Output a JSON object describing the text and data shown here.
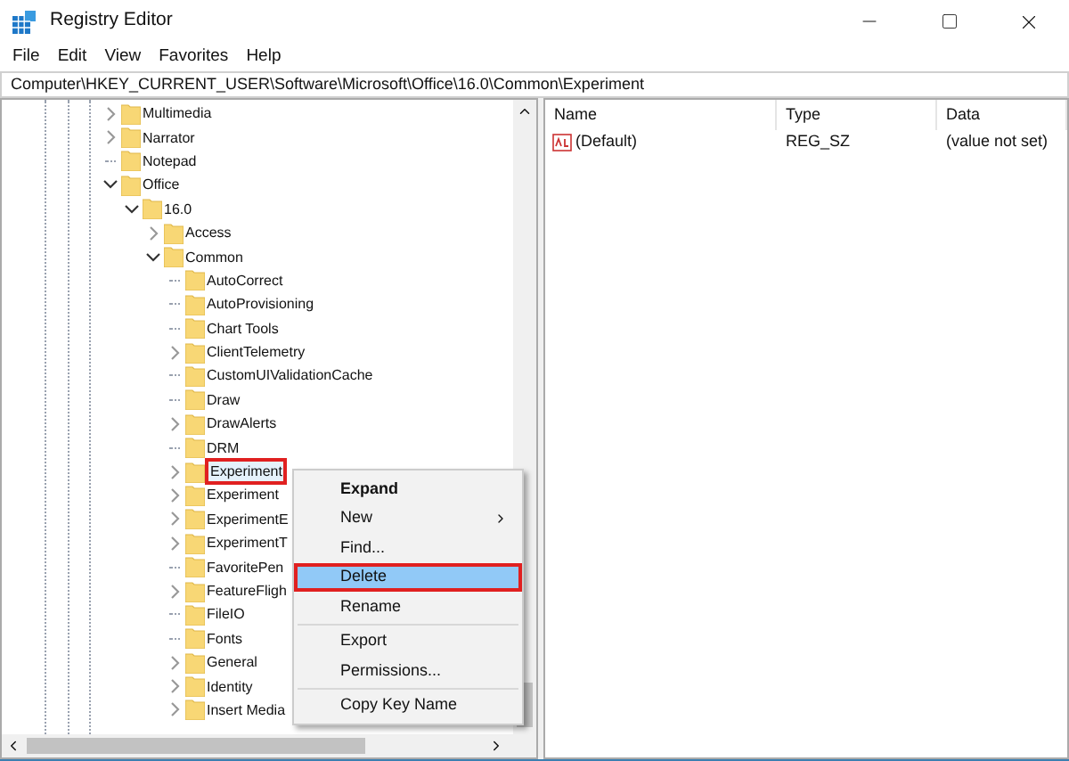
{
  "window": {
    "title": "Registry Editor"
  },
  "menu_bar": [
    "File",
    "Edit",
    "View",
    "Favorites",
    "Help"
  ],
  "address": "Computer\\HKEY_CURRENT_USER\\Software\\Microsoft\\Office\\16.0\\Common\\Experiment",
  "tree": [
    {
      "label": "Multimedia",
      "expandable": true,
      "expanded": false,
      "selected": false
    },
    {
      "label": "Narrator",
      "expandable": true,
      "expanded": false,
      "selected": false
    },
    {
      "label": "Notepad",
      "expandable": false,
      "selected": false
    },
    {
      "label": "Office",
      "expandable": true,
      "expanded": true,
      "selected": false,
      "children": [
        {
          "label": "16.0",
          "expandable": true,
          "expanded": true,
          "selected": false,
          "children": [
            {
              "label": "Access",
              "expandable": true,
              "expanded": false,
              "selected": false
            },
            {
              "label": "Common",
              "expandable": true,
              "expanded": true,
              "selected": false,
              "children": [
                {
                  "label": "AutoCorrect",
                  "expandable": false,
                  "selected": false
                },
                {
                  "label": "AutoProvisioning",
                  "expandable": false,
                  "selected": false
                },
                {
                  "label": "Chart Tools",
                  "expandable": false,
                  "selected": false
                },
                {
                  "label": "ClientTelemetry",
                  "expandable": true,
                  "expanded": false,
                  "selected": false
                },
                {
                  "label": "CustomUIValidationCache",
                  "expandable": false,
                  "selected": false
                },
                {
                  "label": "Draw",
                  "expandable": false,
                  "selected": false
                },
                {
                  "label": "DrawAlerts",
                  "expandable": true,
                  "expanded": false,
                  "selected": false
                },
                {
                  "label": "DRM",
                  "expandable": false,
                  "selected": false
                },
                {
                  "label": "Experiment",
                  "expandable": true,
                  "expanded": false,
                  "selected": true
                },
                {
                  "label": "Experiment",
                  "expandable": true,
                  "expanded": false,
                  "selected": false
                },
                {
                  "label": "ExperimentE",
                  "expandable": true,
                  "expanded": false,
                  "selected": false
                },
                {
                  "label": "ExperimentT",
                  "expandable": true,
                  "expanded": false,
                  "selected": false
                },
                {
                  "label": "FavoritePen",
                  "expandable": false,
                  "selected": false
                },
                {
                  "label": "FeatureFligh",
                  "expandable": true,
                  "expanded": false,
                  "selected": false
                },
                {
                  "label": "FileIO",
                  "expandable": false,
                  "selected": false
                },
                {
                  "label": "Fonts",
                  "expandable": false,
                  "selected": false
                },
                {
                  "label": "General",
                  "expandable": true,
                  "expanded": false,
                  "selected": false
                },
                {
                  "label": "Identity",
                  "expandable": true,
                  "expanded": false,
                  "selected": false
                },
                {
                  "label": "Insert Media",
                  "expandable": true,
                  "expanded": false,
                  "selected": false
                }
              ]
            }
          ]
        }
      ]
    }
  ],
  "values": {
    "columns": [
      "Name",
      "Type",
      "Data"
    ],
    "rows": [
      {
        "name": "(Default)",
        "type": "REG_SZ",
        "data": "(value not set)"
      }
    ]
  },
  "context_menu": {
    "groups": [
      [
        {
          "label": "Expand",
          "bold": true,
          "submenu": false,
          "highlighted": false
        },
        {
          "label": "New",
          "bold": false,
          "submenu": true,
          "highlighted": false
        },
        {
          "label": "Find...",
          "bold": false,
          "submenu": false,
          "highlighted": false
        },
        {
          "label": "Delete",
          "bold": false,
          "submenu": false,
          "highlighted": true
        },
        {
          "label": "Rename",
          "bold": false,
          "submenu": false,
          "highlighted": false
        }
      ],
      [
        {
          "label": "Export",
          "bold": false,
          "submenu": false,
          "highlighted": false
        },
        {
          "label": "Permissions...",
          "bold": false,
          "submenu": false,
          "highlighted": false
        }
      ],
      [
        {
          "label": "Copy Key Name",
          "bold": false,
          "submenu": false,
          "highlighted": false
        }
      ]
    ]
  }
}
